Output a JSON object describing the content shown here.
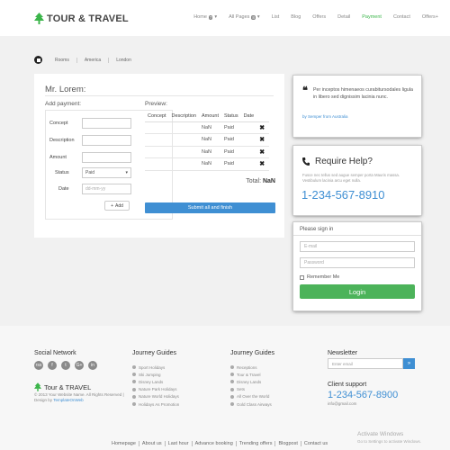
{
  "header": {
    "logo_text": "TOUR & TRAVEL",
    "nav": [
      {
        "label": "Home",
        "badge": "▾"
      },
      {
        "label": "All Pages",
        "badge": "▾"
      },
      {
        "label": "List"
      },
      {
        "label": "Blog"
      },
      {
        "label": "Offers"
      },
      {
        "label": "Detail"
      },
      {
        "label": "Payment",
        "active": true
      },
      {
        "label": "Contact"
      },
      {
        "label": "Offers+"
      }
    ]
  },
  "breadcrumb": [
    "Rooms",
    "America",
    "London"
  ],
  "payment_panel": {
    "title": "Mr. Lorem:",
    "add_payment_heading": "Add payment:",
    "fields": {
      "concept_label": "Concept",
      "description_label": "Description",
      "amount_label": "Amount",
      "status_label": "Status",
      "status_value": "Paid",
      "date_label": "Date",
      "date_placeholder": "dd-mm-yy"
    },
    "add_button": "Add",
    "preview_heading": "Preview:",
    "table_headers": [
      "Concept",
      "Description",
      "Amount",
      "Status",
      "Date"
    ],
    "rows": [
      {
        "amount": "NaN",
        "status": "Paid"
      },
      {
        "amount": "NaN",
        "status": "Paid"
      },
      {
        "amount": "NaN",
        "status": "Paid"
      },
      {
        "amount": "NaN",
        "status": "Paid"
      }
    ],
    "total_label": "Total:",
    "total_value": "NaN",
    "submit_button": "Submit all and finish"
  },
  "testimonial": {
    "text": "Per inceptos himenaeos curabitursodales ligula in libero sed dignissim lacinia nunc.",
    "author": "by Semper from Australia"
  },
  "help": {
    "title": "Require Help?",
    "text": "Fusce nec tellus sed augue semper porta Mauris massa. Vestibulum lacinia arcu eget nulla.",
    "phone": "1-234-567-8910"
  },
  "signin": {
    "title": "Please sign in",
    "email_placeholder": "E-mail",
    "password_placeholder": "Password",
    "remember_label": "Remember Me",
    "login_button": "Login"
  },
  "footer": {
    "social_heading": "Social Network",
    "social_icons": [
      "rss",
      "f",
      "t",
      "G+",
      "in"
    ],
    "logo_text": "Tour & TRAVEL",
    "copyright": "© 2013 Your Website Name. All Rights Reserved | Design by",
    "copyright_link": "TemplateOnWeb",
    "journey_heading_1": "Journey Guides",
    "journey_list_1": [
      "Sport Holidays",
      "Ski Jumping",
      "Disney Lands",
      "Nature Park Holidays",
      "Nature World Holidays",
      "Holidays As Promotion"
    ],
    "journey_heading_2": "Journey Guides",
    "journey_list_2": [
      "Receptions",
      "Tour & Travel",
      "Disney Lands",
      "Sets",
      "All Over the World",
      "Gold Class Airways"
    ],
    "newsletter_heading": "Newsletter",
    "newsletter_placeholder": "Enter email",
    "newsletter_button": "»",
    "support_heading": "Client support",
    "support_phone": "1-234-567-8900",
    "support_email": "info@gmail.com",
    "bottom_nav": [
      "Homepage",
      "About us",
      "Last hour",
      "Advance booking",
      "Trending offers",
      "Blogpost",
      "Contact us"
    ]
  },
  "watermark": {
    "line1": "Activate Windows",
    "line2": "Go to Settings to activate Windows."
  },
  "colors": {
    "accent_blue": "#3f8fd3",
    "accent_green": "#4cb35a",
    "band_gray": "#f1f1f1"
  }
}
